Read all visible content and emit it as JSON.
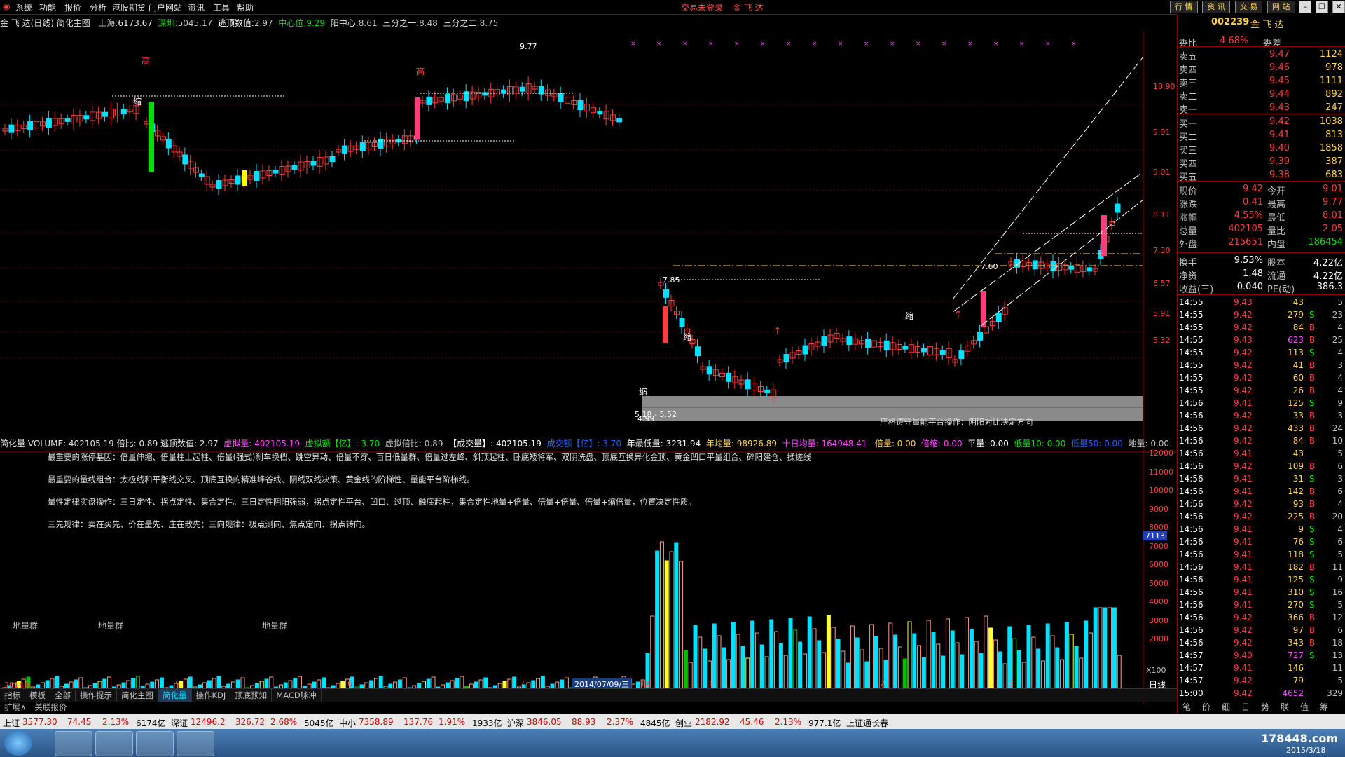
{
  "menu": {
    "items": [
      "系统",
      "功能",
      "报价",
      "分析",
      "港股期货",
      "门户网站",
      "资讯",
      "工具",
      "帮助"
    ],
    "center_status": "交易未登录",
    "center_name": "金 飞 达",
    "right_buttons": [
      "行 情",
      "资 讯",
      "交 易",
      "网 站"
    ]
  },
  "info_line": {
    "title": "金 飞 达(日线) 简化主图",
    "sh_label": "上海:",
    "sh_val": "6173.67",
    "sz_label": "深圳:",
    "sz_val": "5045.17",
    "escape_label": "逃顶数值:",
    "escape_val": "2.97",
    "center_label": "中心位:",
    "center_val": "9.29",
    "yang_label": "阳中心:",
    "yang_val": "8.61",
    "third1_label": "三分之一:",
    "third1_val": "8.48",
    "third2_label": "三分之二:",
    "third2_val": "8.75"
  },
  "chart_labels": {
    "gao1": "高",
    "gao2": "高",
    "suo1": "缩",
    "suo2": "缩",
    "suo3": "缩",
    "suo4": "缩",
    "price_top": "9.77",
    "label_p1": "7.85",
    "label_p2": "7.60",
    "low_label": "4.99",
    "low_range": "5.18 - 5.52",
    "strict_note": "严格遵守量能平台操作：阴阳对比决定方向",
    "year": "2014年",
    "date_box": "2014/07/09/三",
    "x_ticks": [
      "5",
      "6",
      "7",
      "12",
      "1",
      "2",
      "3"
    ],
    "ground_labels": [
      "地量群",
      "地量群",
      "地量群"
    ],
    "vol_scale_mark": "7113",
    "x100": "X100",
    "day_label": "日线"
  },
  "price_axis": [
    "10.90",
    "9.91",
    "9.01",
    "8.11",
    "7.30",
    "6.57",
    "5.91",
    "5.32"
  ],
  "vol_axis": [
    "12000",
    "11000",
    "10000",
    "9000",
    "8000",
    "7000",
    "6000",
    "5000",
    "4000",
    "3000",
    "2000"
  ],
  "vol_info": {
    "head": "简化量 VOLUME: 402105.19 倍比: 0.89 逃顶数值: 2.97",
    "virtual": "虚拟量: 402105.19",
    "virtual_amt": "虚拟额【亿】: 3.70",
    "virtual_ratio": "虚拟倍比: 0.89",
    "deal": "【成交量】: 402105.19",
    "deal_amt": "成交额【亿】: 3.70",
    "year_low": "年最低量: 3231.94",
    "year_avg": "年均量: 98926.89",
    "ten_avg": "十日均量: 164948.41",
    "double": "倍量: 0.00",
    "half": "倍缩: 0.00",
    "flat": "平量: 0.00",
    "low10": "低量10: 0.00",
    "low50": "低量50: 0.00",
    "ground": "地量: 0.00"
  },
  "notes": [
    "最重要的涨停基因：倍量伸缩、倍量柱上起柱、倍量(强式)刹车换档、跳空异动、倍量不穿、百日低量群、倍量过左峰、斜顶起柱、卧底矮将军、双阴洗盘、顶底互换异化金顶、黄金凹口平量组合、碎阳建仓、揉搓线",
    "最重要的量线组合：太极线和平衡线交叉、顶底互换的精准峰谷线、阴线双线决策、黄金线的阶梯性、量能平台阶梯线。",
    "量性定律实盘操作：三日定性、拐点定性、集合定性。三日定性阴阳强弱，拐点定性平台、凹口、过顶、触底起柱，集合定性地量+倍量、倍量+倍量、倍量+缩倍量，位置决定性质。",
    "三先规律：卖在买先、价在量先、庄在散先；三向规律：极点测向、焦点定向、拐点转向。"
  ],
  "quote": {
    "code": "002239",
    "name": "金 飞 达",
    "weibi_label": "委比",
    "weibi_val": "4.68%",
    "weicha_label": "委差",
    "weicha_val": "",
    "sells": [
      {
        "label": "卖五",
        "price": "9.47",
        "vol": "1124"
      },
      {
        "label": "卖四",
        "price": "9.46",
        "vol": "978"
      },
      {
        "label": "卖三",
        "price": "9.45",
        "vol": "1111"
      },
      {
        "label": "卖二",
        "price": "9.44",
        "vol": "892"
      },
      {
        "label": "卖一",
        "price": "9.43",
        "vol": "247"
      }
    ],
    "buys": [
      {
        "label": "买一",
        "price": "9.42",
        "vol": "1038"
      },
      {
        "label": "买二",
        "price": "9.41",
        "vol": "813"
      },
      {
        "label": "买三",
        "price": "9.40",
        "vol": "1858"
      },
      {
        "label": "买四",
        "price": "9.39",
        "vol": "387"
      },
      {
        "label": "买五",
        "price": "9.38",
        "vol": "683"
      }
    ],
    "stats": [
      {
        "l1": "现价",
        "v1": "9.42",
        "l2": "今开",
        "v2": "9.01"
      },
      {
        "l1": "涨跌",
        "v1": "0.41",
        "l2": "最高",
        "v2": "9.77"
      },
      {
        "l1": "涨幅",
        "v1": "4.55%",
        "l2": "最低",
        "v2": "8.01"
      },
      {
        "l1": "总量",
        "v1": "402105",
        "l2": "量比",
        "v2": "2.05"
      },
      {
        "l1": "外盘",
        "v1": "215651",
        "l2": "内盘",
        "v2": "186454"
      }
    ],
    "stats2": [
      {
        "l1": "换手",
        "v1": "9.53%",
        "l2": "股本",
        "v2": "4.22亿"
      },
      {
        "l1": "净资",
        "v1": "1.48",
        "l2": "流通",
        "v2": "4.22亿"
      },
      {
        "l1": "收益(三)",
        "v1": "0.040",
        "l2": "PE(动)",
        "v2": "386.3"
      }
    ]
  },
  "ticks": [
    [
      "14:55",
      "9.43",
      "43",
      "",
      "5"
    ],
    [
      "14:55",
      "9.42",
      "279",
      "S",
      "23"
    ],
    [
      "14:55",
      "9.42",
      "84",
      "B",
      "4"
    ],
    [
      "14:55",
      "9.43",
      "623",
      "B",
      "25"
    ],
    [
      "14:55",
      "9.42",
      "113",
      "S",
      "4"
    ],
    [
      "14:55",
      "9.42",
      "41",
      "B",
      "3"
    ],
    [
      "14:55",
      "9.42",
      "60",
      "B",
      "4"
    ],
    [
      "14:55",
      "9.42",
      "26",
      "B",
      "4"
    ],
    [
      "14:56",
      "9.41",
      "125",
      "S",
      "9"
    ],
    [
      "14:56",
      "9.42",
      "33",
      "B",
      "3"
    ],
    [
      "14:56",
      "9.42",
      "433",
      "B",
      "24"
    ],
    [
      "14:56",
      "9.42",
      "84",
      "B",
      "10"
    ],
    [
      "14:56",
      "9.41",
      "43",
      "",
      "5"
    ],
    [
      "14:56",
      "9.42",
      "109",
      "B",
      "6"
    ],
    [
      "14:56",
      "9.41",
      "31",
      "S",
      "3"
    ],
    [
      "14:56",
      "9.41",
      "142",
      "B",
      "6"
    ],
    [
      "14:56",
      "9.42",
      "93",
      "B",
      "4"
    ],
    [
      "14:56",
      "9.42",
      "225",
      "B",
      "20"
    ],
    [
      "14:56",
      "9.41",
      "9",
      "S",
      "4"
    ],
    [
      "14:56",
      "9.41",
      "76",
      "S",
      "6"
    ],
    [
      "14:56",
      "9.41",
      "118",
      "S",
      "5"
    ],
    [
      "14:56",
      "9.41",
      "182",
      "B",
      "11"
    ],
    [
      "14:56",
      "9.41",
      "125",
      "S",
      "9"
    ],
    [
      "14:56",
      "9.41",
      "310",
      "S",
      "16"
    ],
    [
      "14:56",
      "9.41",
      "270",
      "S",
      "5"
    ],
    [
      "14:56",
      "9.42",
      "366",
      "B",
      "12"
    ],
    [
      "14:56",
      "9.42",
      "97",
      "B",
      "6"
    ],
    [
      "14:56",
      "9.42",
      "343",
      "B",
      "18"
    ],
    [
      "14:57",
      "9.40",
      "727",
      "S",
      "13"
    ],
    [
      "14:57",
      "9.41",
      "146",
      "",
      "11"
    ],
    [
      "14:57",
      "9.42",
      "79",
      "",
      "5"
    ],
    [
      "15:00",
      "9.42",
      "4652",
      "",
      "329"
    ]
  ],
  "tabs": [
    "指标",
    "模板",
    "全部",
    "操作提示",
    "简化主图",
    "简化量",
    "操作KDJ",
    "顶底预知",
    "MACD脉冲"
  ],
  "tabs2": [
    "扩展∧",
    "关联报价"
  ],
  "right_tabs": [
    "笔",
    "价",
    "细",
    "日",
    "势",
    "联",
    "值",
    "筹"
  ],
  "status": [
    {
      "name": "上证",
      "val": "3577.30",
      "chg": "74.45",
      "pct": "2.13%",
      "amt": "6174亿"
    },
    {
      "name": "深证",
      "val": "12496.2",
      "chg": "326.72",
      "pct": "2.68%",
      "amt": "5045亿"
    },
    {
      "name": "中小",
      "val": "7358.89",
      "chg": "137.76",
      "pct": "1.91%",
      "amt": "1933亿"
    },
    {
      "name": "沪深",
      "val": "3846.05",
      "chg": "88.93",
      "pct": "2.37%",
      "amt": "4845亿"
    },
    {
      "name": "创业",
      "val": "2182.92",
      "chg": "45.46",
      "pct": "2.13%",
      "amt": "977.1亿"
    }
  ],
  "status_right": "上证通长春",
  "taskbar": {
    "clock_date": "2015/3/18",
    "watermark": "178448.com"
  },
  "colors": {
    "up": "#ff3c3c",
    "down": "#00e0ff",
    "bg": "#000000",
    "grid": "#8b0000"
  }
}
